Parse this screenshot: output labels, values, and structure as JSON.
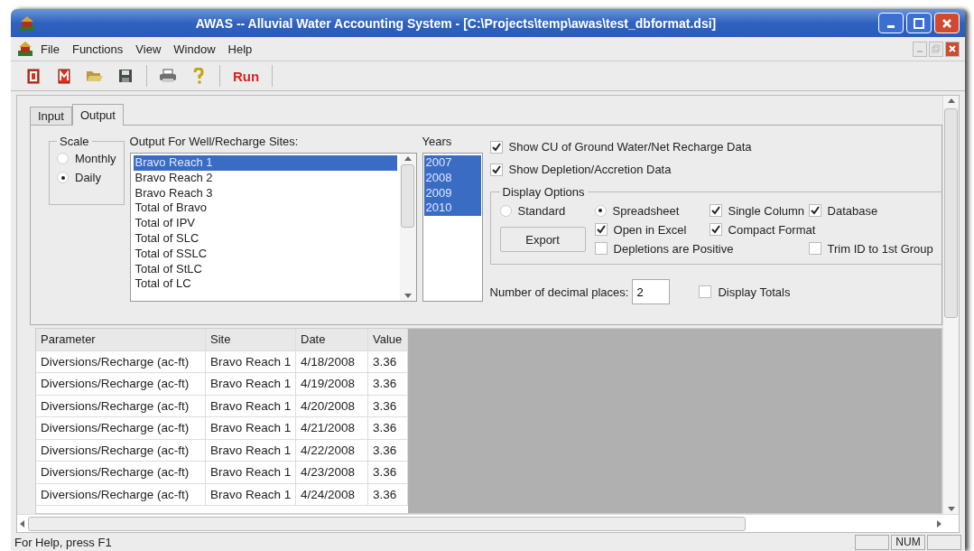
{
  "window": {
    "title": "AWAS -- Alluvial Water Accounting System - [C:\\Projects\\temp\\awas\\test_dbformat.dsi]"
  },
  "menu": [
    {
      "label": "File"
    },
    {
      "label": "Functions"
    },
    {
      "label": "View"
    },
    {
      "label": "Window"
    },
    {
      "label": "Help"
    }
  ],
  "toolbar": {
    "run_label": "Run"
  },
  "tabs": [
    {
      "label": "Input",
      "selected": false
    },
    {
      "label": "Output",
      "selected": true
    }
  ],
  "scale": {
    "title": "Scale",
    "options": [
      {
        "label": "Monthly",
        "selected": false
      },
      {
        "label": "Daily",
        "selected": true
      }
    ]
  },
  "sites": {
    "label": "Output For Well/Recharge Sites:",
    "items": [
      {
        "label": "Bravo Reach 1",
        "selected": true
      },
      {
        "label": "Bravo Reach 2",
        "selected": false
      },
      {
        "label": "Bravo Reach 3",
        "selected": false
      },
      {
        "label": "Total of Bravo",
        "selected": false
      },
      {
        "label": "Total of IPV",
        "selected": false
      },
      {
        "label": "Total of SLC",
        "selected": false
      },
      {
        "label": "Total of SSLC",
        "selected": false
      },
      {
        "label": "Total of StLC",
        "selected": false
      },
      {
        "label": "Total of LC",
        "selected": false
      }
    ]
  },
  "years": {
    "label": "Years",
    "items": [
      {
        "label": "2007",
        "selected": true
      },
      {
        "label": "2008",
        "selected": true
      },
      {
        "label": "2009",
        "selected": true
      },
      {
        "label": "2010",
        "selected": true
      }
    ]
  },
  "show_options": [
    {
      "label": "Show CU of Ground Water/Net Recharge Data",
      "checked": true
    },
    {
      "label": "Show Depletion/Accretion Data",
      "checked": true
    }
  ],
  "display_options": {
    "title": "Display Options",
    "export_button": "Export",
    "modes": [
      {
        "label": "Standard",
        "selected": false
      },
      {
        "label": "Spreadsheet",
        "selected": true
      }
    ],
    "checks": [
      {
        "label": "Single Column",
        "checked": true
      },
      {
        "label": "Database",
        "checked": true
      },
      {
        "label": "Open in Excel",
        "checked": true
      },
      {
        "label": "Compact Format",
        "checked": true
      },
      {
        "label": "Depletions are Positive",
        "checked": false
      },
      {
        "label": "Trim ID to 1st Group",
        "checked": false
      }
    ]
  },
  "decimal_places": {
    "label": "Number of decimal places:",
    "value": "2"
  },
  "display_totals": {
    "label": "Display Totals",
    "checked": false
  },
  "table": {
    "columns": [
      "Parameter",
      "Site",
      "Date",
      "Value"
    ],
    "rows": [
      [
        "Diversions/Recharge (ac-ft)",
        "Bravo Reach 1",
        "4/18/2008",
        "3.36"
      ],
      [
        "Diversions/Recharge (ac-ft)",
        "Bravo Reach 1",
        "4/19/2008",
        "3.36"
      ],
      [
        "Diversions/Recharge (ac-ft)",
        "Bravo Reach 1",
        "4/20/2008",
        "3.36"
      ],
      [
        "Diversions/Recharge (ac-ft)",
        "Bravo Reach 1",
        "4/21/2008",
        "3.36"
      ],
      [
        "Diversions/Recharge (ac-ft)",
        "Bravo Reach 1",
        "4/22/2008",
        "3.36"
      ],
      [
        "Diversions/Recharge (ac-ft)",
        "Bravo Reach 1",
        "4/23/2008",
        "3.36"
      ],
      [
        "Diversions/Recharge (ac-ft)",
        "Bravo Reach 1",
        "4/24/2008",
        "3.36"
      ]
    ]
  },
  "status_bar": {
    "text": "For Help, press F1",
    "indicators": [
      "NUM"
    ]
  }
}
